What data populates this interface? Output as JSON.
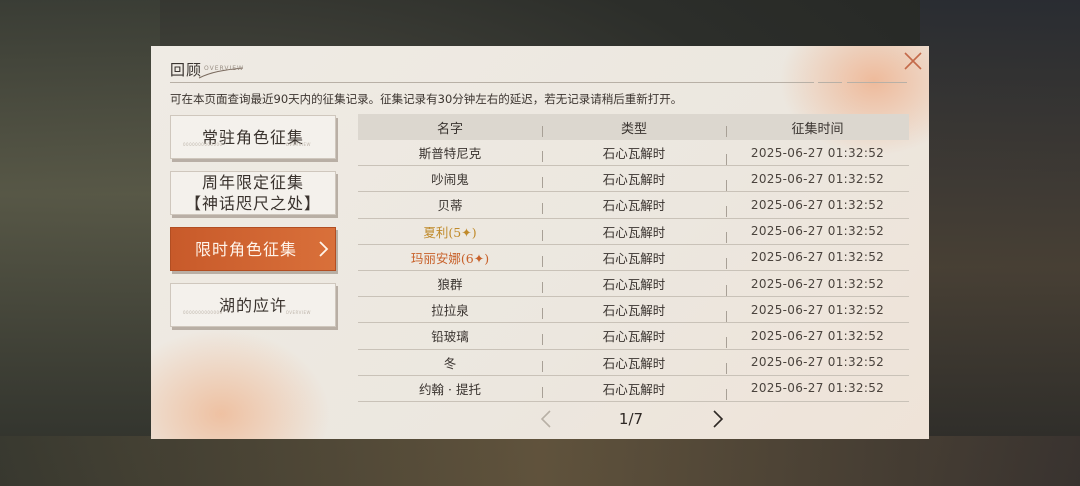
{
  "dialog": {
    "title": "回顾",
    "subtitle": "OVERVIEW",
    "notice": "可在本页面查询最近90天内的征集记录。征集记录有30分钟左右的延迟，若无记录请稍后重新打开。"
  },
  "sidebar": {
    "items": [
      {
        "line1": "常驻角色征集",
        "line2": "",
        "active": false
      },
      {
        "line1": "周年限定征集",
        "line2": "【神话咫尺之处】",
        "active": false
      },
      {
        "line1": "限时角色征集",
        "line2": "",
        "active": true
      },
      {
        "line1": "湖的应许",
        "line2": "",
        "active": false
      }
    ],
    "tag_left": "0000000000000",
    "tag_right": "OVERVIEW"
  },
  "table": {
    "headers": [
      "名字",
      "类型",
      "征集时间"
    ],
    "rows": [
      {
        "name": "斯普特尼克",
        "type": "石心瓦解时",
        "time": "2025-06-27 01:32:52",
        "rarity": ""
      },
      {
        "name": "吵闹鬼",
        "type": "石心瓦解时",
        "time": "2025-06-27 01:32:52",
        "rarity": ""
      },
      {
        "name": "贝蒂",
        "type": "石心瓦解时",
        "time": "2025-06-27 01:32:52",
        "rarity": ""
      },
      {
        "name": "夏利(5✦)",
        "type": "石心瓦解时",
        "time": "2025-06-27 01:32:52",
        "rarity": "5"
      },
      {
        "name": "玛丽安娜(6✦)",
        "type": "石心瓦解时",
        "time": "2025-06-27 01:32:52",
        "rarity": "6"
      },
      {
        "name": "狼群",
        "type": "石心瓦解时",
        "time": "2025-06-27 01:32:52",
        "rarity": ""
      },
      {
        "name": "拉拉泉",
        "type": "石心瓦解时",
        "time": "2025-06-27 01:32:52",
        "rarity": ""
      },
      {
        "name": "铅玻璃",
        "type": "石心瓦解时",
        "time": "2025-06-27 01:32:52",
        "rarity": ""
      },
      {
        "name": "冬",
        "type": "石心瓦解时",
        "time": "2025-06-27 01:32:52",
        "rarity": ""
      },
      {
        "name": "约翰 · 提托",
        "type": "石心瓦解时",
        "time": "2025-06-27 01:32:52",
        "rarity": ""
      }
    ]
  },
  "pager": {
    "label": "1/7",
    "prev_icon": "chevron-left-icon",
    "next_icon": "chevron-right-icon"
  },
  "colors": {
    "accent": "#c85a2a",
    "rare5": "#c08a2a",
    "rare6": "#c8612a",
    "panel": "#efebe4"
  }
}
